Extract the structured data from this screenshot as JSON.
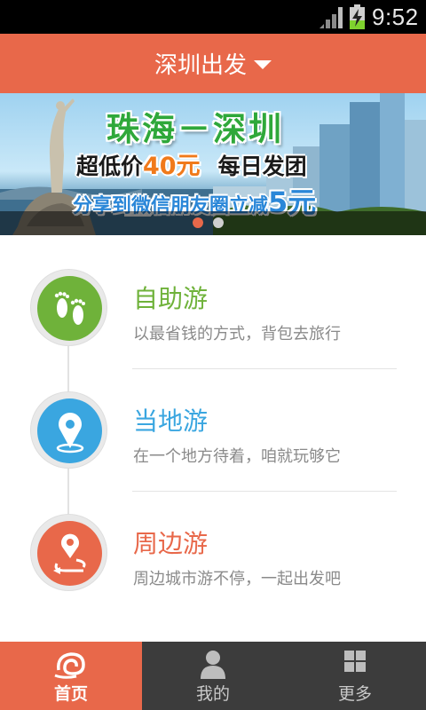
{
  "status_bar": {
    "time": "9:52"
  },
  "header": {
    "city_label": "深圳出发"
  },
  "banner": {
    "headline": "珠海－深圳",
    "line2_prefix": "超低价",
    "line2_price": "40元",
    "line2_suffix": "每日发团",
    "line3_prefix": "分享到微信朋友圈立减",
    "line3_amount": "5元",
    "page_indicator": {
      "count": 2,
      "active_index": 0
    }
  },
  "menu": {
    "items": [
      {
        "title": "自助游",
        "desc": "以最省钱的方式，背包去旅行",
        "color": "#6fb23a",
        "icon": "footprints-icon"
      },
      {
        "title": "当地游",
        "desc": "在一个地方待着，咱就玩够它",
        "color": "#3aa6e0",
        "icon": "location-pin-icon"
      },
      {
        "title": "周边游",
        "desc": "周边城市游不停，一起出发吧",
        "color": "#e8684a",
        "icon": "route-pin-icon"
      }
    ]
  },
  "tabbar": {
    "tabs": [
      {
        "label": "首页",
        "icon": "home-logo-icon",
        "active": true
      },
      {
        "label": "我的",
        "icon": "user-icon",
        "active": false
      },
      {
        "label": "更多",
        "icon": "grid-icon",
        "active": false
      }
    ]
  },
  "colors": {
    "accent": "#e8684a",
    "tabbar_bg": "#3c3c3c"
  }
}
